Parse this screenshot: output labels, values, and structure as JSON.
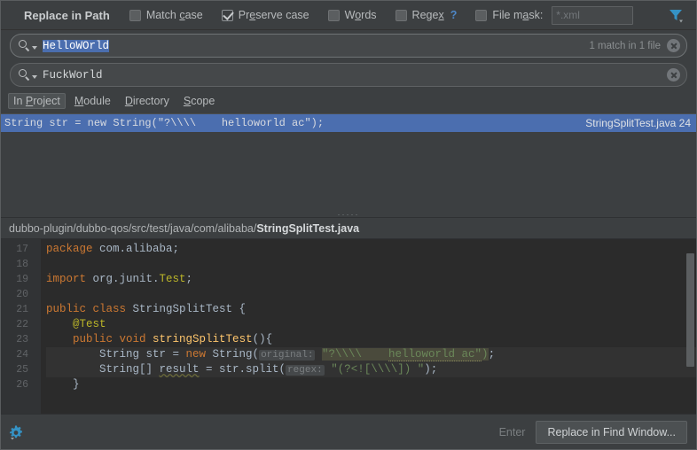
{
  "header": {
    "title": "Replace in Path",
    "options": [
      {
        "name": "match-case",
        "label_pre": "Match ",
        "label_u": "c",
        "label_post": "ase",
        "checked": false
      },
      {
        "name": "preserve-case",
        "label_pre": "Pr",
        "label_u": "e",
        "label_post": "serve case",
        "checked": true
      },
      {
        "name": "words",
        "label_pre": "W",
        "label_u": "o",
        "label_post": "rds",
        "checked": false
      },
      {
        "name": "regex",
        "label_pre": "Rege",
        "label_u": "x",
        "label_post": "",
        "checked": false,
        "help": "?"
      }
    ],
    "file_mask": {
      "label_pre": "File m",
      "label_u": "a",
      "label_post": "sk:",
      "checked": false,
      "value": "",
      "placeholder": "*.xml"
    },
    "filter_icon": "filter-funnel-icon"
  },
  "search_field": {
    "icon": "search-icon",
    "value": "HelloWOrld",
    "selected": true,
    "status": "1 match in 1 file",
    "clear_icon": "clear-circle-icon"
  },
  "replace_field": {
    "icon": "search-icon",
    "value": "FuckWorld",
    "clear_icon": "clear-circle-icon"
  },
  "scope": {
    "items": [
      {
        "name": "in-project",
        "pre": "In ",
        "u": "P",
        "post": "roject",
        "active": true
      },
      {
        "name": "module",
        "pre": "",
        "u": "M",
        "post": "odule",
        "active": false
      },
      {
        "name": "directory",
        "pre": "",
        "u": "D",
        "post": "irectory",
        "active": false
      },
      {
        "name": "scope",
        "pre": "",
        "u": "S",
        "post": "cope",
        "active": false
      }
    ]
  },
  "results": {
    "rows": [
      {
        "prefix": "String str = new String(\"?\\\\\\\\    ",
        "match": "helloworld",
        "suffix": " ac\");",
        "location": "StringSplitTest.java  24",
        "selected": true
      }
    ]
  },
  "splitter": {
    "handle": "·····"
  },
  "path_bar": {
    "dir": "dubbo-plugin/dubbo-qos/src/test/java/com/alibaba/",
    "file": "StringSplitTest.java"
  },
  "preview": {
    "line_numbers": [
      "17",
      "18",
      "19",
      "20",
      "21",
      "22",
      "23",
      "24",
      "25",
      "26"
    ],
    "lines": [
      {
        "n": "17",
        "run": "none",
        "text": "package com.alibaba;",
        "highlight": false
      },
      {
        "n": "18",
        "run": "none",
        "text": "",
        "highlight": false
      },
      {
        "n": "19",
        "run": "none",
        "text": "import org.junit.Test;",
        "highlight": false
      },
      {
        "n": "20",
        "run": "none",
        "text": "",
        "highlight": false
      },
      {
        "n": "21",
        "run": "double",
        "text": "public class StringSplitTest {",
        "highlight": false
      },
      {
        "n": "22",
        "run": "none",
        "text": "    @Test",
        "highlight": false
      },
      {
        "n": "23",
        "run": "single",
        "text": "    public void stringSplitTest(){",
        "highlight": false
      },
      {
        "n": "24",
        "run": "none",
        "text": "        String str = new String( original: \"?\\\\\\\\    helloworld ac\");",
        "highlight": true
      },
      {
        "n": "25",
        "run": "none",
        "text": "        String[] result = str.split( regex: \"(?<![\\\\\\\\]) \");",
        "highlight": true
      },
      {
        "n": "26",
        "run": "none",
        "text": "    }",
        "highlight": false
      }
    ],
    "inlay_hints": {
      "original": "original:",
      "regex": "regex:"
    },
    "scrollbar": "vertical-scrollbar"
  },
  "footer": {
    "settings_icon": "gear-icon",
    "enter_hint": "Enter",
    "primary_button": "Replace in Find Window..."
  },
  "colors": {
    "window_bg": "#3c3f41",
    "editor_bg": "#2b2b2b",
    "selection_blue": "#4b6eaf",
    "match_highlight": "#f2e2b0",
    "accent_blue": "#4e87c7",
    "keyword_orange": "#cc7832",
    "string_green": "#6a8759",
    "method_yellow": "#ffc66d",
    "annotation_olive": "#bbb529",
    "run_green": "#499c54"
  }
}
